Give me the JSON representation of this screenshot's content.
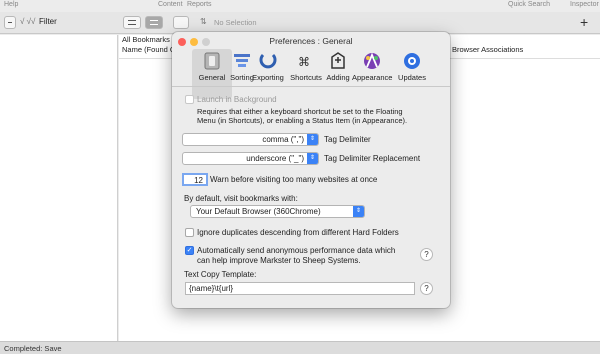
{
  "topbar": {
    "help": "Help",
    "content": "Content",
    "reports": "Reports",
    "quick_search": "Quick Search",
    "inspector": "Inspector"
  },
  "toolbar": {
    "filter_label": "Filter",
    "no_selection": "No Selection"
  },
  "main": {
    "all_bookmarks": "All Bookmarks &",
    "col_name": "Name  (Found O",
    "col_browser": "Browser Associations"
  },
  "statusbar": {
    "text": "Completed: Save"
  },
  "dialog": {
    "title": "Preferences : General",
    "tabs": [
      {
        "label": "General",
        "icon": "general-icon",
        "color": "#9a9a9a"
      },
      {
        "label": "Sorting",
        "icon": "sorting-icon",
        "color": "#4a73c8"
      },
      {
        "label": "Exporting",
        "icon": "exporting-icon",
        "color": "#2f5fb0"
      },
      {
        "label": "Shortcuts",
        "icon": "shortcuts-icon",
        "color": "#444444"
      },
      {
        "label": "Adding",
        "icon": "adding-icon",
        "color": "#333333"
      },
      {
        "label": "Appearance",
        "icon": "appearance-icon",
        "color": "#7a3fb4"
      },
      {
        "label": "Updates",
        "icon": "updates-icon",
        "color": "#2f6fe0"
      }
    ],
    "launch_bg": "Launch in Background",
    "launch_note1": "Requires that either a keyboard shortcut be set to the Floating",
    "launch_note2": "Menu (in Shortcuts), or enabling a Status Item (in Appearance).",
    "tag_delim_value": "comma (\",\")",
    "tag_delim_label": "Tag Delimiter",
    "tag_repl_value": "underscore (\"_\")",
    "tag_repl_label": "Tag Delimiter Replacement",
    "warn_count": "12",
    "warn_label": "Warn before visiting too many websites at once",
    "visit_label": "By default, visit bookmarks with:",
    "browser_value": "Your Default Browser (360Chrome)",
    "ignore_dupes": "Ignore duplicates descending from different Hard Folders",
    "anon_line1": "Automatically send anonymous performance data which",
    "anon_line2": "can help improve Markster to Sheep Systems.",
    "copy_template_label": "Text Copy Template:",
    "copy_template_value": "{name}\\t{url}"
  }
}
